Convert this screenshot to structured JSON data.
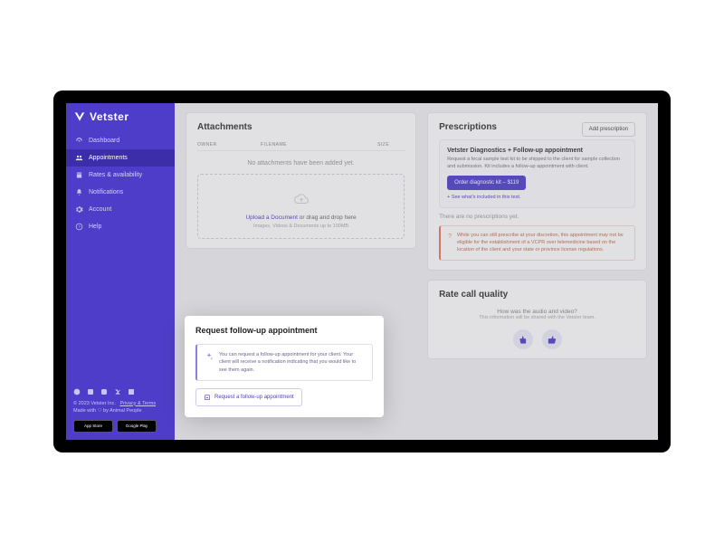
{
  "brand": "Vetster",
  "sidebar": {
    "items": [
      {
        "label": "Dashboard"
      },
      {
        "label": "Appointments"
      },
      {
        "label": "Rates & availability"
      },
      {
        "label": "Notifications"
      },
      {
        "label": "Account"
      },
      {
        "label": "Help"
      }
    ]
  },
  "footer": {
    "copyright": "© 2023 Vetster Inc.",
    "privacy": "Privacy & Terms",
    "made": "Made with ♡ by Animal People",
    "appstore": "App Store",
    "playstore": "Google Play"
  },
  "attachments": {
    "title": "Attachments",
    "cols": {
      "owner": "OWNER",
      "filename": "FILENAME",
      "size": "SIZE"
    },
    "empty": "No attachments have been added yet.",
    "upload_link": "Upload a Document",
    "upload_rest": " or drag and drop here",
    "upload_sub": "Images, Videos & Documents up to 100MB"
  },
  "followup": {
    "title": "Request follow-up appointment",
    "info": "You can request a follow-up appointment for your client. Your client will receive a notification indicating that you would like to see them again.",
    "button": "Request a follow-up appointment"
  },
  "prescriptions": {
    "title": "Prescriptions",
    "add": "Add prescription",
    "promo_title": "Vetster Diagnostics + Follow-up appointment",
    "promo_desc": "Request a fecal sample test kit to be shipped to the client for sample collection and submission. Kit includes a follow-up appointment with client.",
    "order_btn": "Order diagnostic kit – $119",
    "see_link": "+ See what's included in this test.",
    "empty": "There are no prescriptions yet.",
    "warn": "While you can still prescribe at your discretion, this appointment may not be eligible for the establishment of a VCPR over telemedicine based on the location of the client and your state or province license regulations."
  },
  "rating": {
    "title": "Rate call quality",
    "q": "How was the audio and video?",
    "sub": "This information will be shared with the Vetster team."
  }
}
